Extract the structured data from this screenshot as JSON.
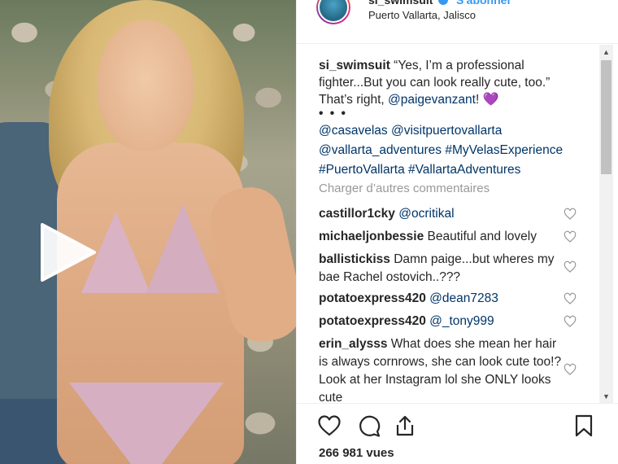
{
  "header": {
    "username": "si_swimsuit",
    "follow_label": "S'abonner",
    "location": "Puerto Vallarta, Jalisco"
  },
  "caption": {
    "user": "si_swimsuit",
    "text_1": " “Yes, I’m a professional fighter...But you can look really cute, too.” That’s right, ",
    "mention": "@paigevanzant",
    "text_2": "! ",
    "heart": "💜",
    "dots": "• • •",
    "tags_line_1": "@casavelas @visitpuertovallarta",
    "tags_line_2": "@vallarta_adventures #MyVelasExperience",
    "tags_line_3": "#PuertoVallarta #VallartaAdventures"
  },
  "load_more": "Charger d’autres commentaires",
  "comments": [
    {
      "user": "castillor1cky",
      "text": " ",
      "mention": "@ocritikal"
    },
    {
      "user": "michaeljonbessie",
      "text": " Beautiful and lovely",
      "mention": ""
    },
    {
      "user": "ballistickiss",
      "text": " Damn paige...but wheres my bae Rachel ostovich..???",
      "mention": ""
    },
    {
      "user": "potatoexpress420",
      "text": " ",
      "mention": "@dean7283"
    },
    {
      "user": "potatoexpress420",
      "text": " ",
      "mention": "@_tony999"
    },
    {
      "user": "erin_alysss",
      "text": " What does she mean her hair is always cornrows, she can look cute too!? Look at her Instagram lol she ONLY looks cute",
      "mention": ""
    }
  ],
  "views": "266 981 vues",
  "colors": {
    "link": "#003569",
    "accent": "#3897f0",
    "muted": "#999999"
  }
}
